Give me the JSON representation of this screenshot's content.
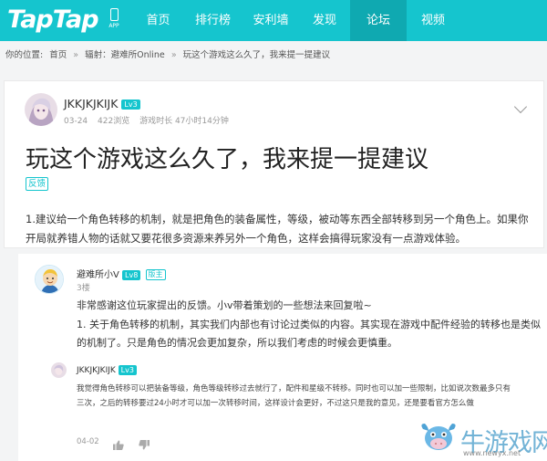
{
  "header": {
    "logo": "TapTap",
    "app_label": "APP",
    "nav": [
      {
        "label": "首页",
        "active": false
      },
      {
        "label": "排行榜",
        "active": false
      },
      {
        "label": "安利墙",
        "active": false
      },
      {
        "label": "发现",
        "active": false
      },
      {
        "label": "论坛",
        "active": true
      },
      {
        "label": "视频",
        "active": false
      }
    ]
  },
  "breadcrumb": {
    "prefix": "你的位置:",
    "items": [
      "首页",
      "»",
      "辐射：避难所Online",
      "»",
      "玩这个游戏这么久了，我来提一提建议"
    ]
  },
  "post": {
    "author": "JKKJKJKIJK",
    "level": "Lv3",
    "date": "03-24",
    "views": "422浏览",
    "playtime": "游戏时长 47小时14分钟",
    "title": "玩这个游戏这么久了，我来提一提建议",
    "tag": "反馈",
    "body": "1.建议给一个角色转移的机制，就是把角色的装备属性，等级，被动等东西全部转移到另一个角色上。如果你开局就养错人物的话就又要花很多资源来养另外一个角色，这样会搞得玩家没有一点游戏体验。"
  },
  "reply": {
    "name": "避难所小V",
    "level": "Lv8",
    "role": "版主",
    "floor": "3楼",
    "line1": "非常感谢这位玩家提出的反馈。小v带着策划的一些想法来回复啦~",
    "line2": "1. 关于角色转移的机制，其实我们内部也有讨论过类似的内容。其实现在游戏中配件经验的转移也是类似的机制了。只是角色的情况会更加复杂，所以我们考虑的时候会更慎重。"
  },
  "sub_reply": {
    "name": "JKKJKJKIJK",
    "level": "Lv3",
    "text": "我觉得角色转移可以把装备等级，角色等级转移过去就行了，配件和星级不转移。同时也可以加一些限制，比如说次数最多只有三次，之后的转移要过24小时才可以加一次转移时间，这样设计会更好，不过这只是我的意见，还是要看官方怎么做",
    "date": "04-02"
  },
  "watermark": {
    "text": "牛游戏网",
    "url": "www.newyx.net"
  },
  "colors": {
    "brand": "#15c5ce",
    "nav_active": "#0fa9b1"
  }
}
